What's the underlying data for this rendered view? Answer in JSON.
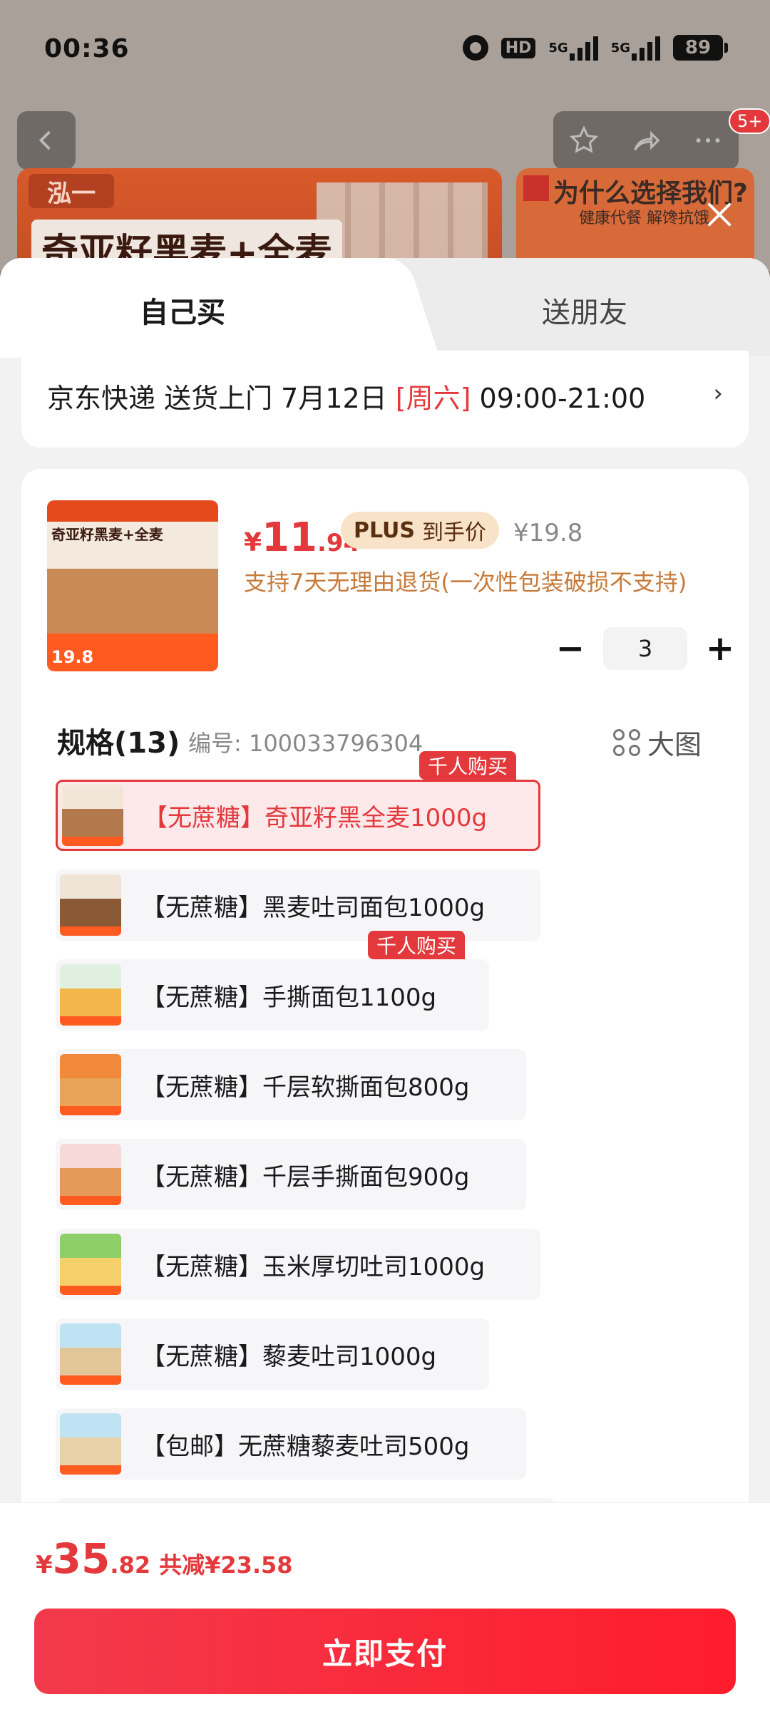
{
  "status_bar": {
    "time": "00:36",
    "battery": "89",
    "network_1": "5G",
    "network_2": "5G"
  },
  "background": {
    "banner_brand": "泓一",
    "banner_headline": "奇亚籽黑麦+全麦",
    "why_choose": "为什么选择我们?",
    "why_sub": "健康代餐 解馋抗饿",
    "message_badge": "5+"
  },
  "tabs": [
    {
      "label": "自己买",
      "active": true
    },
    {
      "label": "送朋友",
      "active": false
    }
  ],
  "delivery": {
    "prefix": "京东快递 送货上门 7月12日 ",
    "day": "[周六]",
    "time": " 09:00-21:00",
    "chevron": "›"
  },
  "product": {
    "thumb_title": "奇亚籽黑麦+全麦",
    "thumb_price": "19.8",
    "price_currency": "¥",
    "price_int": "11",
    "price_dec": ".94",
    "plus_label": "PLUS",
    "plus_suffix": "到手价",
    "original_price": "¥19.8",
    "return_policy": "支持7天无理由退货(一次性包装破损不支持)",
    "quantity": "3",
    "minus": "−",
    "plus": "+"
  },
  "spec": {
    "title": "规格(13)",
    "code": "编号: 100033796304",
    "big_image": "大图",
    "variants": [
      {
        "label": "【无蔗糖】奇亚籽黑全麦1000g",
        "selected": true,
        "hot": "千人购买"
      },
      {
        "label": "【无蔗糖】黑麦吐司面包1000g",
        "selected": false,
        "hot": ""
      },
      {
        "label": "【无蔗糖】手撕面包1100g",
        "selected": false,
        "hot": "千人购买"
      },
      {
        "label": "【无蔗糖】千层软撕面包800g",
        "selected": false,
        "hot": ""
      },
      {
        "label": "【无蔗糖】千层手撕面包900g",
        "selected": false,
        "hot": ""
      },
      {
        "label": "【无蔗糖】玉米厚切吐司1000g",
        "selected": false,
        "hot": ""
      },
      {
        "label": "【无蔗糖】藜麦吐司1000g",
        "selected": false,
        "hot": ""
      },
      {
        "label": "【包邮】无蔗糖藜麦吐司500g",
        "selected": false,
        "hot": ""
      }
    ]
  },
  "footer": {
    "total_currency": "¥",
    "total_int": "35",
    "total_dec": ".82",
    "saved": "共减¥23.58",
    "pay_button": "立即支付"
  },
  "colors": {
    "accent": "#e4393c",
    "plus_bg": "#f8e3c9",
    "return_text": "#c67a3a"
  }
}
